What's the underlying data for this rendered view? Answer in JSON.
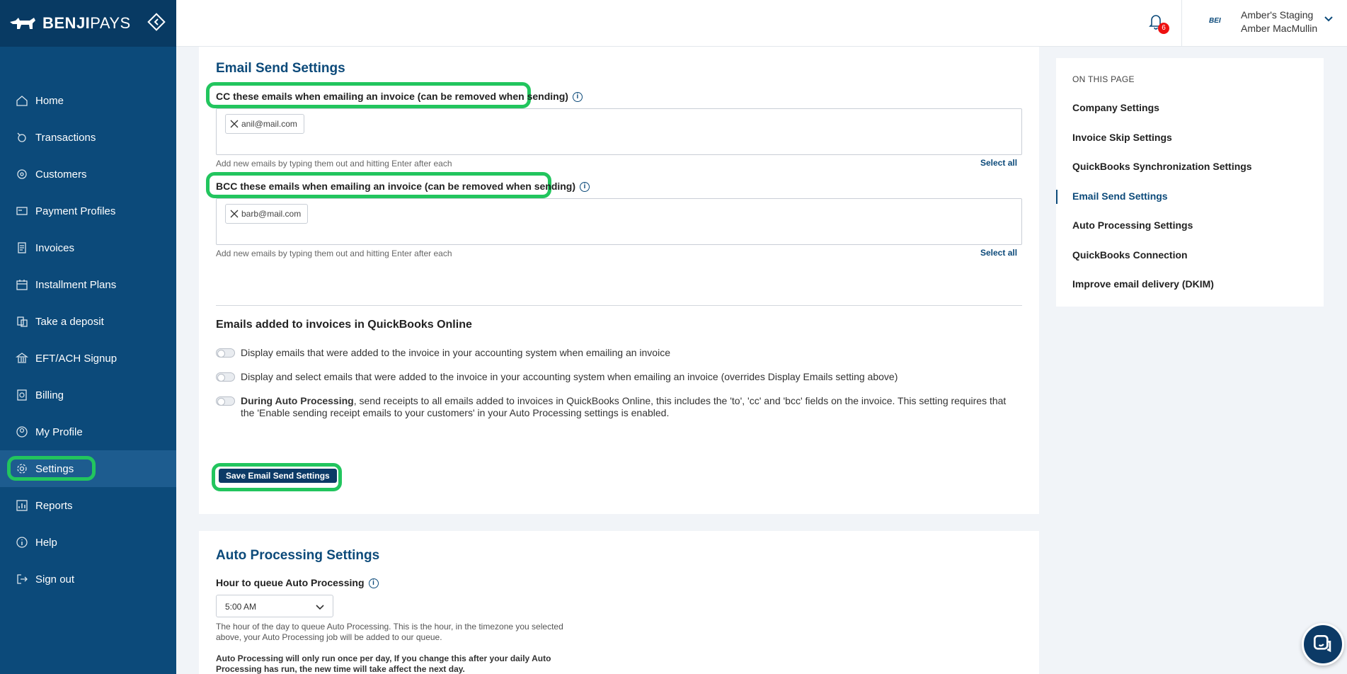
{
  "brand": {
    "name_bold": "BENJI",
    "name_light": "PAYS"
  },
  "sidebar": {
    "items": [
      {
        "label": "Home",
        "icon": "home-icon"
      },
      {
        "label": "Transactions",
        "icon": "transactions-icon"
      },
      {
        "label": "Customers",
        "icon": "customers-icon"
      },
      {
        "label": "Payment Profiles",
        "icon": "payment-profiles-icon"
      },
      {
        "label": "Invoices",
        "icon": "invoices-icon"
      },
      {
        "label": "Installment Plans",
        "icon": "calendar-icon"
      },
      {
        "label": "Take a deposit",
        "icon": "deposit-icon"
      },
      {
        "label": "EFT/ACH Signup",
        "icon": "bank-icon"
      },
      {
        "label": "Billing",
        "icon": "billing-icon"
      },
      {
        "label": "My Profile",
        "icon": "profile-icon"
      },
      {
        "label": "Settings",
        "icon": "gear-icon",
        "active": true
      },
      {
        "label": "Reports",
        "icon": "reports-icon"
      },
      {
        "label": "Help",
        "icon": "help-icon"
      },
      {
        "label": "Sign out",
        "icon": "sign-out-icon"
      }
    ]
  },
  "header": {
    "notification_count": "6",
    "org_logo_text": "BEI",
    "org_name": "Amber's Staging",
    "user_name": "Amber MacMullin"
  },
  "email_send": {
    "title": "Email Send Settings",
    "cc_label": "CC these emails when emailing an invoice (can be removed when sending)",
    "cc_chip": "anil@mail.com",
    "bcc_label": "BCC these emails when emailing an invoice (can be removed when sending)",
    "bcc_chip": "barb@mail.com",
    "help_text": "Add new emails by typing them out and hitting Enter after each",
    "select_all": "Select all",
    "qbo_title": "Emails added to invoices in QuickBooks Online",
    "toggle1": "Display emails that were added to the invoice in your accounting system when emailing an invoice",
    "toggle2": "Display and select emails that were added to the invoice in your accounting system when emailing an invoice (overrides Display Emails setting above)",
    "toggle3_bold": "During Auto Processing",
    "toggle3_rest": ", send receipts to all emails added to invoices in QuickBooks Online, this includes the 'to', 'cc' and 'bcc' fields on the invoice. This setting requires that the 'Enable sending receipt emails to your customers' in your Auto Processing settings is enabled.",
    "save_label": "Save Email Send Settings"
  },
  "auto_processing": {
    "title": "Auto Processing Settings",
    "hour_label": "Hour to queue Auto Processing",
    "hour_value": "5:00 AM",
    "hour_desc": "The hour of the day to queue Auto Processing. This is the hour, in the timezone you selected above, your Auto Processing job will be added to our queue.",
    "note": "Auto Processing will only run once per day, If you change this after your daily Auto Processing has run, the new time will take affect the next day."
  },
  "on_this_page": {
    "title": "ON THIS PAGE",
    "links": [
      "Company Settings",
      "Invoice Skip Settings",
      "QuickBooks Synchronization Settings",
      "Email Send Settings",
      "Auto Processing Settings",
      "QuickBooks Connection",
      "Improve email delivery (DKIM)"
    ],
    "current_index": 3
  },
  "colors": {
    "primary": "#0c4a7a",
    "highlight": "#22c55e",
    "badge": "#ee1111"
  }
}
